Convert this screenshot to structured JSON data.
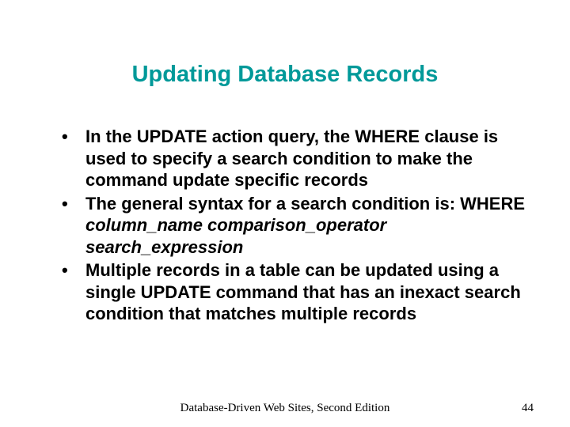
{
  "title": "Updating Database Records",
  "bullets": [
    {
      "pre": "In the UPDATE action query, the WHERE clause is used to specify a search condition to make the command update specific records",
      "italic": "",
      "post": ""
    },
    {
      "pre": "The general syntax for a search condition is: WHERE ",
      "italic": "column_name comparison_operator search_expression",
      "post": ""
    },
    {
      "pre": "Multiple records in a table can be updated using a single UPDATE command that has an inexact search condition that matches multiple records",
      "italic": "",
      "post": ""
    }
  ],
  "footer": {
    "center": "Database-Driven Web Sites, Second Edition",
    "page": "44"
  }
}
